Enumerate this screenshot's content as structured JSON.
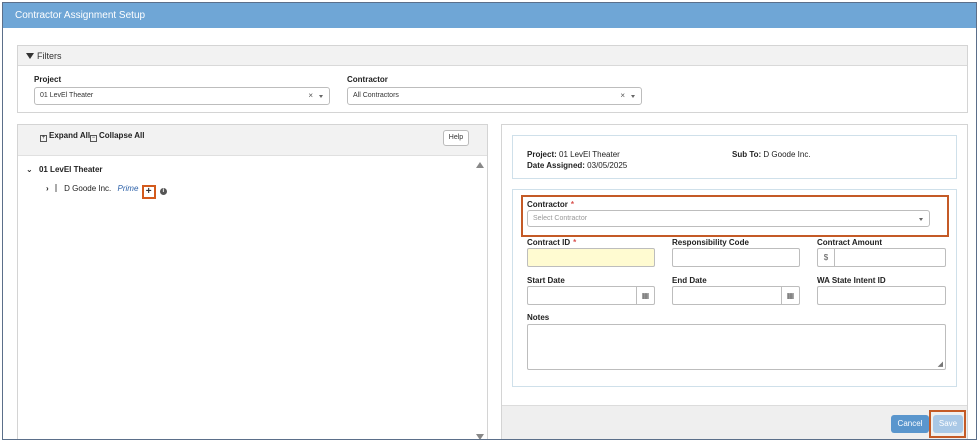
{
  "window": {
    "title": "Contractor Assignment Setup"
  },
  "filters": {
    "header": "Filters",
    "project_label": "Project",
    "project_value": "01 LevEl Theater",
    "contractor_label": "Contractor",
    "contractor_value": "All Contractors",
    "clear_glyph": "×"
  },
  "tree": {
    "expand_all": "Expand All",
    "collapse_all": "Collapse All",
    "help": "Help",
    "root": "01 LevEl Theater",
    "child_name": "D Goode Inc.",
    "child_type": "Prime",
    "add_glyph": "+",
    "info_glyph": "i"
  },
  "summary": {
    "project_label": "Project:",
    "project_value": "01 LevEl Theater",
    "date_label": "Date Assigned:",
    "date_value": "03/05/2025",
    "subto_label": "Sub To:",
    "subto_value": "D Goode Inc."
  },
  "form": {
    "contractor_label": "Contractor",
    "contractor_placeholder": "Select Contractor",
    "contract_id_label": "Contract ID",
    "resp_code_label": "Responsibility Code",
    "amount_label": "Contract Amount",
    "currency_symbol": "$",
    "start_label": "Start Date",
    "end_label": "End Date",
    "wa_label": "WA State Intent ID",
    "notes_label": "Notes",
    "required_mark": "*"
  },
  "actions": {
    "cancel": "Cancel",
    "save": "Save"
  },
  "colors": {
    "titlebar": "#6fa6d6",
    "highlight": "#c45a26",
    "cancel": "#5a96cd",
    "save": "#a9c8e6",
    "required_field": "#fffbd1"
  }
}
